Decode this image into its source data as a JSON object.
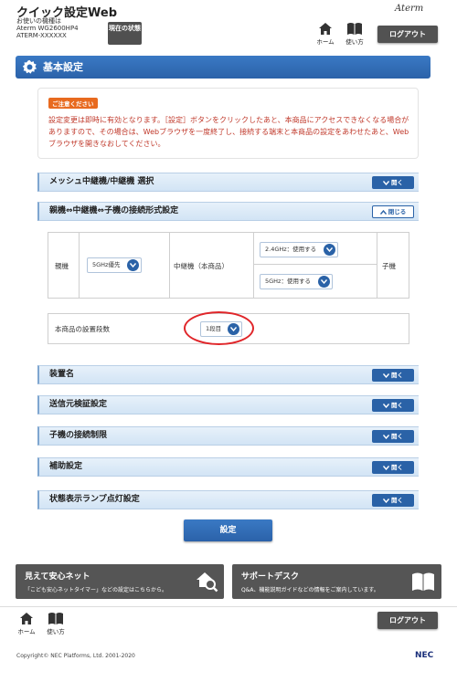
{
  "header": {
    "app_title": "クイック設定Web",
    "device_caption": "お使いの機種は",
    "device_model": "Aterm WG2600HP4",
    "device_id": "ATERM-XXXXXX",
    "status_button": "現在の状態",
    "brand": "Aterm",
    "home_label": "ホーム",
    "usage_label": "使い方",
    "logout_label": "ログアウト"
  },
  "section": {
    "title": "基本設定"
  },
  "notice": {
    "badge": "ご注意ください",
    "text": "設定変更は即時に有効となります。［設定］ボタンをクリックしたあと、本商品にアクセスできなくなる場合がありますので、その場合は、Webブラウザを一度終了し、接続する端末と本商品の設定をあわせたあと、Webブラウザを開きなおしてください。"
  },
  "accordions": [
    {
      "label": "メッシュ中継機/中継機 選択",
      "button": "開く"
    },
    {
      "label": "親機⇔中継機⇔子機の接続形式設定",
      "button": "閉じる"
    },
    {
      "label": "装置名",
      "button": "開く"
    },
    {
      "label": "送信元検証設定",
      "button": "開く"
    },
    {
      "label": "子機の接続制限",
      "button": "開く"
    },
    {
      "label": "補助設定",
      "button": "開く"
    },
    {
      "label": "状態表示ランプ点灯設定",
      "button": "開く"
    }
  ],
  "connection": {
    "parent_label": "親機",
    "parent_select": "5GHz優先",
    "repeater_label": "中継機（本商品）",
    "repeater_24": "2.4GHz：使用する",
    "repeater_5": "5GHz：使用する",
    "child_label": "子機"
  },
  "install_count": {
    "label": "本商品の設置段数",
    "value": "1段目"
  },
  "apply_button": "設定",
  "banners": {
    "safe_net_title": "見えて安心ネット",
    "safe_net_sub": "「こども安心ネットタイマー」などの設定はこちらから。",
    "support_title": "サポートデスク",
    "support_sub": "Q&A、機能説明ガイドなどの情報をご案内しています。"
  },
  "footer": {
    "home_label": "ホーム",
    "usage_label": "使い方",
    "logout_label": "ログアウト",
    "copyright": "Copyright© NEC Platforms, Ltd. 2001-2020",
    "nec_logo": "NEC"
  },
  "icons": [
    "home-icon",
    "book-icon",
    "gear-icon",
    "chevron-down-icon",
    "chevron-up-icon",
    "magnifier-house-icon"
  ],
  "colors": {
    "primary_blue": "#2b62a9",
    "accordion_bg": "#d8e7f6",
    "notice_red": "#c0392b",
    "badge_orange": "#e86a1f",
    "highlight_red": "#e0262a",
    "dark_gray": "#525252"
  }
}
